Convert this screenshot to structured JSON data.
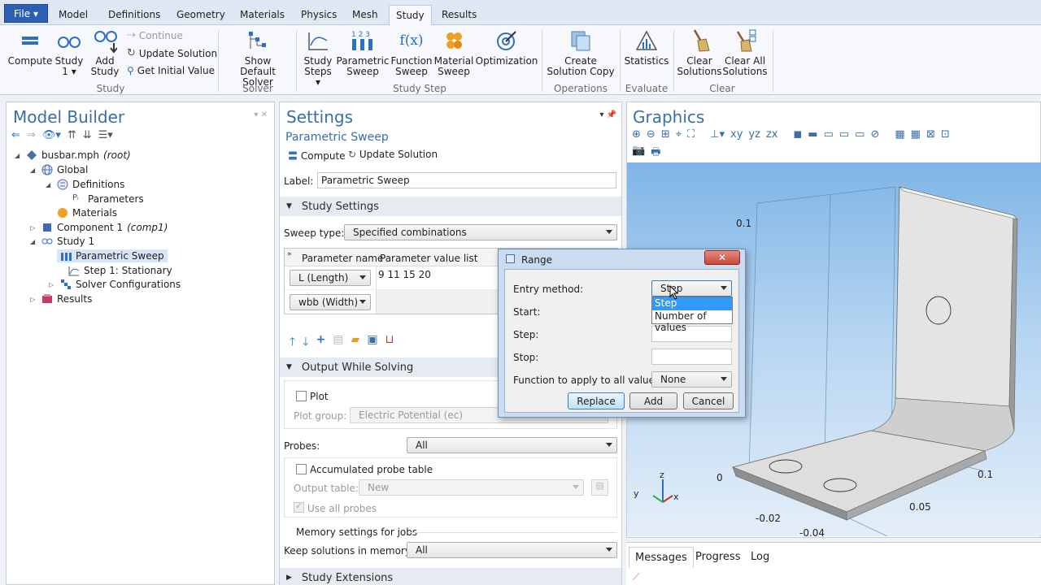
{
  "ribbon": {
    "file_label": "File",
    "tabs": [
      "Model",
      "Definitions",
      "Geometry",
      "Materials",
      "Physics",
      "Mesh",
      "Study",
      "Results"
    ],
    "active_tab": "Study",
    "compute": "Compute",
    "study1": "Study",
    "study1_sub": "1",
    "add_study": "Add",
    "add_study2": "Study",
    "continue": "Continue",
    "update_solution": "Update Solution",
    "get_initial_value": "Get Initial Value",
    "group_study": "Study",
    "show_default_solver": "Show",
    "show_default_solver2": "Default Solver",
    "group_solver": "Solver",
    "study_steps": "Study",
    "study_steps2": "Steps",
    "parametric_sweep": "Parametric",
    "parametric_sweep2": "Sweep",
    "function_sweep": "Function",
    "function_sweep2": "Sweep",
    "material_sweep": "Material",
    "material_sweep2": "Sweep",
    "optimization": "Optimization",
    "group_study_step": "Study Step",
    "create_solution_copy": "Create",
    "create_solution_copy2": "Solution Copy",
    "group_operations": "Operations",
    "statistics": "Statistics",
    "group_evaluate": "Evaluate",
    "clear_solutions": "Clear",
    "clear_solutions2": "Solutions",
    "clear_all_solutions": "Clear All",
    "clear_all_solutions2": "Solutions",
    "group_clear": "Clear"
  },
  "model_builder": {
    "title": "Model Builder",
    "tree": [
      {
        "label": "busbar.mph",
        "suffix": "(root)"
      },
      {
        "label": "Global"
      },
      {
        "label": "Definitions"
      },
      {
        "label": "Parameters"
      },
      {
        "label": "Materials"
      },
      {
        "label": "Component 1",
        "suffix": "(comp1)"
      },
      {
        "label": "Study 1"
      },
      {
        "label": "Parametric Sweep"
      },
      {
        "label": "Step 1: Stationary"
      },
      {
        "label": "Solver Configurations"
      },
      {
        "label": "Results"
      }
    ]
  },
  "settings": {
    "title": "Settings",
    "subtitle": "Parametric Sweep",
    "compute": "Compute",
    "update_solution": "Update Solution",
    "label_caption": "Label:",
    "label_value": "Parametric Sweep",
    "study_settings": "Study Settings",
    "sweep_type_caption": "Sweep type:",
    "sweep_type": "Specified combinations",
    "table_headers": [
      "Parameter name",
      "Parameter value list"
    ],
    "table_rows": [
      {
        "name": "L (Length)",
        "values": "9 11 15 20"
      },
      {
        "name": "wbb (Width)",
        "values": ""
      }
    ],
    "output_while_solving": "Output While Solving",
    "plot": "Plot",
    "plot_group_caption": "Plot group:",
    "plot_group": "Electric Potential (ec)",
    "probes_caption": "Probes:",
    "probes": "All",
    "accumulated_probe_table": "Accumulated probe table",
    "output_table_caption": "Output table:",
    "output_table": "New",
    "use_all_probes": "Use all probes",
    "memory_settings": "Memory settings for jobs",
    "keep_solutions_caption": "Keep solutions in memory:",
    "keep_solutions": "All",
    "study_extensions": "Study Extensions"
  },
  "graphics": {
    "title": "Graphics",
    "axis_labels": [
      "0.1",
      "0",
      "-0.02",
      "-0.04",
      "0.05",
      "0.1"
    ],
    "triad": {
      "z": "z",
      "y": "y",
      "x": "x"
    }
  },
  "messages": {
    "tabs": [
      "Messages",
      "Progress",
      "Log"
    ]
  },
  "dialog": {
    "title": "Range",
    "entry_method_caption": "Entry method:",
    "entry_method": "Step",
    "options": [
      "Step",
      "Number of values"
    ],
    "start_caption": "Start:",
    "step_caption": "Step:",
    "stop_caption": "Stop:",
    "function_caption": "Function to apply to all values:",
    "function_value": "None",
    "replace": "Replace",
    "add": "Add",
    "cancel": "Cancel"
  },
  "colors": {
    "accent": "#3a6ea8",
    "file_button": "#2a5fb3",
    "selection": "#3399ff",
    "close_button": "#c9483c"
  }
}
